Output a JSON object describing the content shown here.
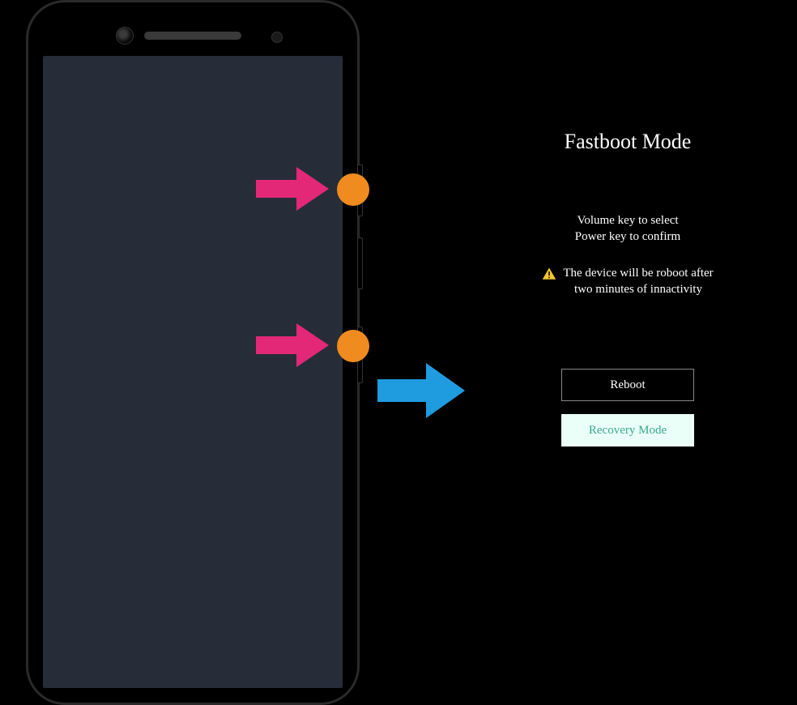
{
  "fastboot": {
    "title": "Fastboot Mode",
    "instruction_line1": "Volume key to select",
    "instruction_line2": "Power key to confirm",
    "warning_line1": "The device will be roboot after",
    "warning_line2": "two minutes of innactivity",
    "reboot_label": "Reboot",
    "recovery_label": "Recovery Mode"
  },
  "colors": {
    "arrow_pink": "#e22877",
    "arrow_blue": "#1f9ce0",
    "marker_orange": "#ef8b1f",
    "warn_yellow": "#f4c430",
    "recovery_bg": "#eafff8",
    "recovery_text": "#3aa88d"
  },
  "markers": {
    "pink_arrow_semantic": "press-button-arrow-icon",
    "orange_dot_semantic": "button-press-marker",
    "blue_arrow_semantic": "leads-to-arrow-icon"
  }
}
